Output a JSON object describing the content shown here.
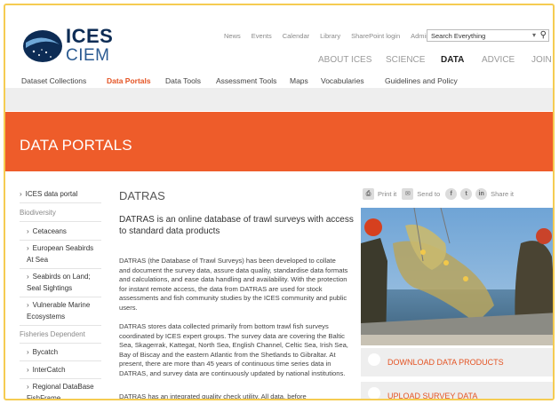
{
  "brand": {
    "name_top": "ICES",
    "name_bottom": "CIEM"
  },
  "utility_links": [
    "News",
    "Events",
    "Calendar",
    "Library",
    "SharePoint login",
    "Admin"
  ],
  "search": {
    "value": "Search Everything"
  },
  "main_nav": [
    "ABOUT ICES",
    "SCIENCE",
    "DATA",
    "ADVICE",
    "JOIN US"
  ],
  "main_nav_active": "DATA",
  "sub_nav": [
    "Dataset Collections",
    "Data Portals",
    "Data Tools",
    "Assessment Tools",
    "Maps",
    "Vocabularies",
    "Guidelines and Policy"
  ],
  "sub_nav_active": "Data Portals",
  "banner": {
    "title": "DATA PORTALS"
  },
  "sidebar": {
    "portal": "ICES data portal",
    "cat_biodiversity": "Biodiversity",
    "cetaceans": "Cetaceans",
    "seabirds_sea": "European Seabirds At Sea",
    "seabirds_land": "Seabirds on Land; Seal Sightings",
    "vme": "Vulnerable Marine Ecosystems",
    "cat_fisheries": "Fisheries Dependent",
    "bycatch": "Bycatch",
    "intercatch": "InterCatch",
    "rdb": "Regional DataBase FishFrame"
  },
  "article": {
    "title": "DATRAS",
    "lead": "DATRAS is an online database of trawl surveys with access to standard data products",
    "p1": "DATRAS (the Database of Trawl Surveys) has been developed to collate and document the survey data, assure data quality, standardise data formats and calculations, and ease data handling and availability. With the protection for instant remote access, the data from DATRAS are used for stock assessments and fish community studies by the ICES community and public users.",
    "p2": "DATRAS stores data collected primarily from bottom trawl fish surveys coordinated by ICES expert groups. The survey data are covering the Baltic Sea, Skagerrak, Kattegat, North Sea, English Channel, Celtic Sea, Irish Sea, Bay of Biscay and the eastern Atlantic from the Shetlands to Gibraltar. At present, there are more than 45 years of continuous time series data in DATRAS, and survey data are continuously updated by national institutions.",
    "p3": "DATRAS has an integrated quality check utility. All data, before"
  },
  "share": {
    "print": "Print it",
    "send": "Send to",
    "share": "Share it"
  },
  "buttons": {
    "download": "DOWNLOAD DATA PRODUCTS",
    "upload": "UPLOAD SURVEY DATA"
  },
  "colors": {
    "accent": "#ee5c2a",
    "active_link": "#e45424",
    "brand_dark": "#0d2c55"
  }
}
